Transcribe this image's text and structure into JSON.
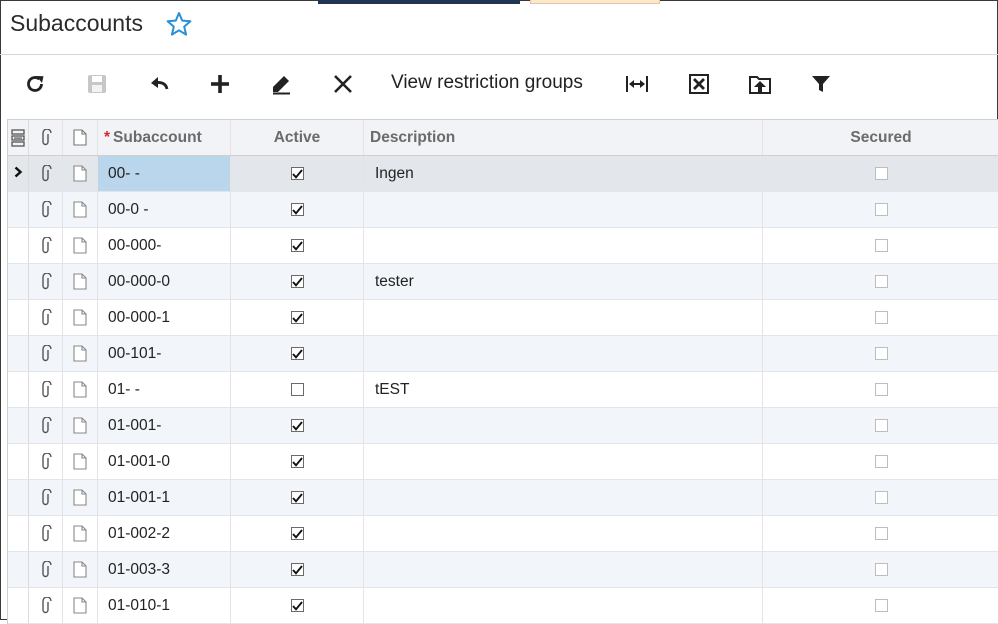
{
  "page": {
    "title": "Subaccounts",
    "accent_color": "#2b8fd6"
  },
  "toolbar": {
    "icons": [
      "refresh-icon",
      "save-icon",
      "undo-icon",
      "add-icon",
      "edit-icon",
      "delete-icon",
      "fit-columns-icon",
      "export-excel-icon",
      "upload-icon",
      "filter-icon"
    ],
    "view_restriction_label": "View restriction groups"
  },
  "grid": {
    "columns": {
      "subaccount": "Subaccount",
      "active": "Active",
      "description": "Description",
      "secured": "Secured"
    },
    "rows": [
      {
        "subaccount": "00- -",
        "active": true,
        "description": "Ingen",
        "secured": false,
        "selected": true
      },
      {
        "subaccount": "00-0 -",
        "active": true,
        "description": "",
        "secured": false
      },
      {
        "subaccount": "00-000-",
        "active": true,
        "description": "",
        "secured": false
      },
      {
        "subaccount": "00-000-0",
        "active": true,
        "description": "tester",
        "secured": false
      },
      {
        "subaccount": "00-000-1",
        "active": true,
        "description": "",
        "secured": false
      },
      {
        "subaccount": "00-101-",
        "active": true,
        "description": "",
        "secured": false
      },
      {
        "subaccount": "01- -",
        "active": false,
        "description": "tEST",
        "secured": false
      },
      {
        "subaccount": "01-001-",
        "active": true,
        "description": "",
        "secured": false
      },
      {
        "subaccount": "01-001-0",
        "active": true,
        "description": "",
        "secured": false
      },
      {
        "subaccount": "01-001-1",
        "active": true,
        "description": "",
        "secured": false
      },
      {
        "subaccount": "01-002-2",
        "active": true,
        "description": "",
        "secured": false
      },
      {
        "subaccount": "01-003-3",
        "active": true,
        "description": "",
        "secured": false
      },
      {
        "subaccount": "01-010-1",
        "active": true,
        "description": "",
        "secured": false
      }
    ]
  }
}
